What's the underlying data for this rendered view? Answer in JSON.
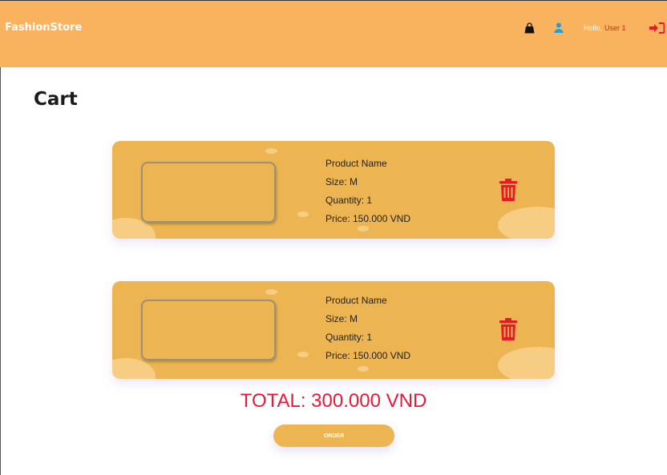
{
  "header": {
    "brand": "FashionStore",
    "greeting": "Hello,",
    "username": "User 1",
    "icons": [
      "shopping-bag-icon",
      "user-icon",
      "logout-icon"
    ]
  },
  "page": {
    "title": "Cart"
  },
  "cart": {
    "items": [
      {
        "name": "Product Name",
        "size": "Size: M",
        "quantity": "Quantity: 1",
        "price": "Price: 150.000 VND"
      },
      {
        "name": "Product Name",
        "size": "Size: M",
        "quantity": "Quantity: 1",
        "price": "Price: 150.000 VND"
      }
    ],
    "total": "TOTAL: 300.000 VND",
    "order_label": "ORDER"
  },
  "colors": {
    "header_bg": "#f9b25d",
    "card_bg": "#ecb552",
    "accent_red": "#e8192c",
    "total_text": "#e8193b"
  }
}
